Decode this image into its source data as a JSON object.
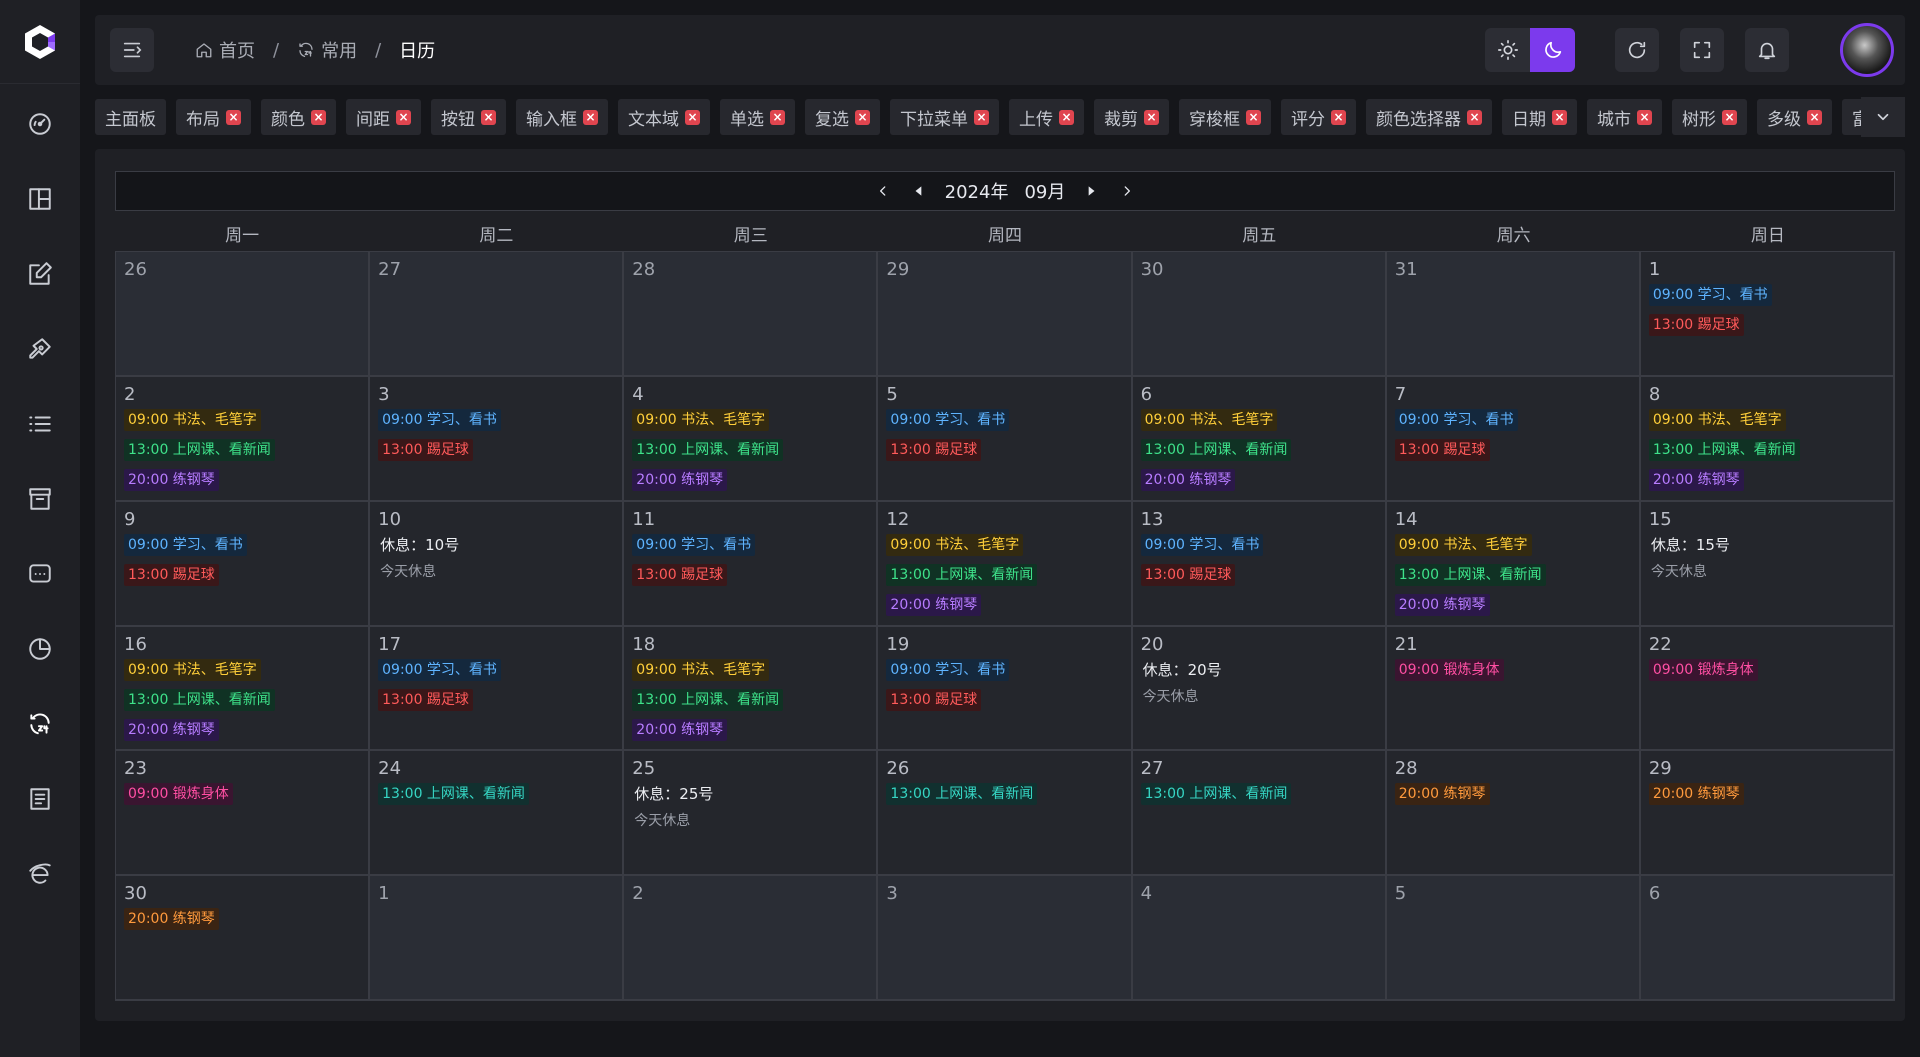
{
  "header": {
    "breadcrumb": [
      {
        "label": "首页",
        "icon": "home-icon"
      },
      {
        "label": "常用",
        "icon": "refresh-24-icon"
      },
      {
        "label": "日历"
      }
    ],
    "separator": "/",
    "theme": "dark"
  },
  "tabs": [
    {
      "label": "主面板",
      "closable": false
    },
    {
      "label": "布局",
      "closable": true
    },
    {
      "label": "颜色",
      "closable": true
    },
    {
      "label": "间距",
      "closable": true
    },
    {
      "label": "按钮",
      "closable": true
    },
    {
      "label": "输入框",
      "closable": true
    },
    {
      "label": "文本域",
      "closable": true
    },
    {
      "label": "单选",
      "closable": true
    },
    {
      "label": "复选",
      "closable": true
    },
    {
      "label": "下拉菜单",
      "closable": true
    },
    {
      "label": "上传",
      "closable": true
    },
    {
      "label": "裁剪",
      "closable": true
    },
    {
      "label": "穿梭框",
      "closable": true
    },
    {
      "label": "评分",
      "closable": true
    },
    {
      "label": "颜色选择器",
      "closable": true
    },
    {
      "label": "日期",
      "closable": true
    },
    {
      "label": "城市",
      "closable": true
    },
    {
      "label": "树形",
      "closable": true
    },
    {
      "label": "多级",
      "closable": true
    },
    {
      "label": "富文本",
      "closable": false
    }
  ],
  "calendar": {
    "year_label": "2024年",
    "month_label": "09月",
    "weekdays": [
      "周一",
      "周二",
      "周三",
      "周四",
      "周五",
      "周六",
      "周日"
    ],
    "colors": {
      "blue": "#5fb4ff",
      "red": "#ff5a5a",
      "yellow": "#ffcf3a",
      "green": "#3ee28a",
      "purple": "#b77cff",
      "pink": "#ff4fa3",
      "teal": "#36d6c4",
      "orange": "#ff9a3d"
    },
    "days": [
      {
        "d": "26",
        "other": true,
        "events": []
      },
      {
        "d": "27",
        "other": true,
        "events": []
      },
      {
        "d": "28",
        "other": true,
        "events": []
      },
      {
        "d": "29",
        "other": true,
        "events": []
      },
      {
        "d": "30",
        "other": true,
        "events": []
      },
      {
        "d": "31",
        "other": true,
        "events": []
      },
      {
        "d": "1",
        "events": [
          {
            "t": "09:00 学习、看书",
            "c": "blue"
          },
          {
            "t": "13:00 踢足球",
            "c": "red"
          }
        ]
      },
      {
        "d": "2",
        "events": [
          {
            "t": "09:00 书法、毛笔字",
            "c": "yellow"
          },
          {
            "t": "13:00 上网课、看新闻",
            "c": "green"
          },
          {
            "t": "20:00 练钢琴",
            "c": "purple"
          }
        ]
      },
      {
        "d": "3",
        "events": [
          {
            "t": "09:00 学习、看书",
            "c": "blue"
          },
          {
            "t": "13:00 踢足球",
            "c": "red"
          }
        ]
      },
      {
        "d": "4",
        "events": [
          {
            "t": "09:00 书法、毛笔字",
            "c": "yellow"
          },
          {
            "t": "13:00 上网课、看新闻",
            "c": "green"
          },
          {
            "t": "20:00 练钢琴",
            "c": "purple"
          }
        ]
      },
      {
        "d": "5",
        "events": [
          {
            "t": "09:00 学习、看书",
            "c": "blue"
          },
          {
            "t": "13:00 踢足球",
            "c": "red"
          }
        ]
      },
      {
        "d": "6",
        "events": [
          {
            "t": "09:00 书法、毛笔字",
            "c": "yellow"
          },
          {
            "t": "13:00 上网课、看新闻",
            "c": "green"
          },
          {
            "t": "20:00 练钢琴",
            "c": "purple"
          }
        ]
      },
      {
        "d": "7",
        "events": [
          {
            "t": "09:00 学习、看书",
            "c": "blue"
          },
          {
            "t": "13:00 踢足球",
            "c": "red"
          }
        ]
      },
      {
        "d": "8",
        "events": [
          {
            "t": "09:00 书法、毛笔字",
            "c": "yellow"
          },
          {
            "t": "13:00 上网课、看新闻",
            "c": "green"
          },
          {
            "t": "20:00 练钢琴",
            "c": "purple"
          }
        ]
      },
      {
        "d": "9",
        "events": [
          {
            "t": "09:00 学习、看书",
            "c": "blue"
          },
          {
            "t": "13:00 踢足球",
            "c": "red"
          }
        ]
      },
      {
        "d": "10",
        "rest": {
          "title": "休息：10号",
          "note": "今天休息"
        },
        "events": []
      },
      {
        "d": "11",
        "events": [
          {
            "t": "09:00 学习、看书",
            "c": "blue"
          },
          {
            "t": "13:00 踢足球",
            "c": "red"
          }
        ]
      },
      {
        "d": "12",
        "events": [
          {
            "t": "09:00 书法、毛笔字",
            "c": "yellow"
          },
          {
            "t": "13:00 上网课、看新闻",
            "c": "green"
          },
          {
            "t": "20:00 练钢琴",
            "c": "purple"
          }
        ]
      },
      {
        "d": "13",
        "events": [
          {
            "t": "09:00 学习、看书",
            "c": "blue"
          },
          {
            "t": "13:00 踢足球",
            "c": "red"
          }
        ]
      },
      {
        "d": "14",
        "events": [
          {
            "t": "09:00 书法、毛笔字",
            "c": "yellow"
          },
          {
            "t": "13:00 上网课、看新闻",
            "c": "green"
          },
          {
            "t": "20:00 练钢琴",
            "c": "purple"
          }
        ]
      },
      {
        "d": "15",
        "rest": {
          "title": "休息：15号",
          "note": "今天休息"
        },
        "events": []
      },
      {
        "d": "16",
        "events": [
          {
            "t": "09:00 书法、毛笔字",
            "c": "yellow"
          },
          {
            "t": "13:00 上网课、看新闻",
            "c": "green"
          },
          {
            "t": "20:00 练钢琴",
            "c": "purple"
          }
        ]
      },
      {
        "d": "17",
        "events": [
          {
            "t": "09:00 学习、看书",
            "c": "blue"
          },
          {
            "t": "13:00 踢足球",
            "c": "red"
          }
        ]
      },
      {
        "d": "18",
        "events": [
          {
            "t": "09:00 书法、毛笔字",
            "c": "yellow"
          },
          {
            "t": "13:00 上网课、看新闻",
            "c": "green"
          },
          {
            "t": "20:00 练钢琴",
            "c": "purple"
          }
        ]
      },
      {
        "d": "19",
        "events": [
          {
            "t": "09:00 学习、看书",
            "c": "blue"
          },
          {
            "t": "13:00 踢足球",
            "c": "red"
          }
        ]
      },
      {
        "d": "20",
        "rest": {
          "title": "休息：20号",
          "note": "今天休息"
        },
        "events": []
      },
      {
        "d": "21",
        "events": [
          {
            "t": "09:00 锻炼身体",
            "c": "pink"
          }
        ]
      },
      {
        "d": "22",
        "events": [
          {
            "t": "09:00 锻炼身体",
            "c": "pink"
          }
        ]
      },
      {
        "d": "23",
        "events": [
          {
            "t": "09:00 锻炼身体",
            "c": "pink"
          }
        ]
      },
      {
        "d": "24",
        "events": [
          {
            "t": "13:00 上网课、看新闻",
            "c": "teal"
          }
        ]
      },
      {
        "d": "25",
        "rest": {
          "title": "休息：25号",
          "note": "今天休息"
        },
        "events": []
      },
      {
        "d": "26",
        "events": [
          {
            "t": "13:00 上网课、看新闻",
            "c": "teal"
          }
        ]
      },
      {
        "d": "27",
        "events": [
          {
            "t": "13:00 上网课、看新闻",
            "c": "teal"
          }
        ]
      },
      {
        "d": "28",
        "events": [
          {
            "t": "20:00 练钢琴",
            "c": "orange"
          }
        ]
      },
      {
        "d": "29",
        "events": [
          {
            "t": "20:00 练钢琴",
            "c": "orange"
          }
        ]
      },
      {
        "d": "30",
        "events": [
          {
            "t": "20:00 练钢琴",
            "c": "orange"
          }
        ]
      },
      {
        "d": "1",
        "other": true,
        "events": []
      },
      {
        "d": "2",
        "other": true,
        "events": []
      },
      {
        "d": "3",
        "other": true,
        "events": []
      },
      {
        "d": "4",
        "other": true,
        "events": []
      },
      {
        "d": "5",
        "other": true,
        "events": []
      },
      {
        "d": "6",
        "other": true,
        "events": []
      }
    ]
  },
  "sidebar": {
    "items": [
      {
        "icon": "dashboard-gauge-icon"
      },
      {
        "icon": "layout-icon"
      },
      {
        "icon": "edit-form-icon"
      },
      {
        "icon": "pen-tool-icon"
      },
      {
        "icon": "list-icon"
      },
      {
        "icon": "archive-icon"
      },
      {
        "icon": "message-icon"
      },
      {
        "icon": "pie-chart-icon"
      },
      {
        "icon": "refresh-24-icon",
        "active": true
      },
      {
        "icon": "document-icon"
      },
      {
        "icon": "browser-e-icon"
      }
    ]
  }
}
